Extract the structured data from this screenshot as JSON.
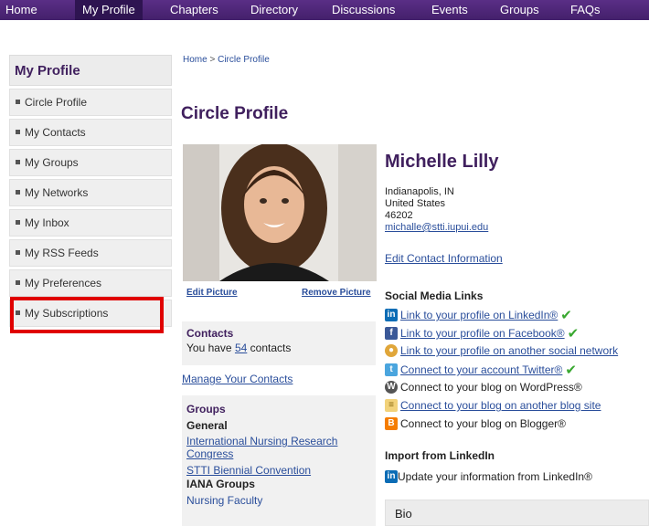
{
  "nav": {
    "items": [
      "Home",
      "My Profile",
      "Chapters",
      "Directory",
      "Discussions",
      "Events",
      "Groups",
      "FAQs"
    ],
    "active": "My Profile"
  },
  "sidebar": {
    "title": "My Profile",
    "items": [
      "Circle Profile",
      "My Contacts",
      "My Groups",
      "My Networks",
      "My Inbox",
      "My RSS Feeds",
      "My Preferences",
      "My Subscriptions"
    ],
    "highlighted": "My Subscriptions"
  },
  "breadcrumb": {
    "home": "Home",
    "sep": " > ",
    "current": "Circle Profile"
  },
  "page": {
    "title": "Circle Profile"
  },
  "photo": {
    "edit_label": "Edit Picture",
    "remove_label": "Remove Picture"
  },
  "profile": {
    "name": "Michelle Lilly",
    "city": "Indianapolis, IN",
    "country": "United States",
    "zip": "46202",
    "email": "michalle@stti.iupui.edu",
    "edit_contact": "Edit Contact Information"
  },
  "social": {
    "title": "Social Media Links",
    "links": [
      {
        "icon": "linkedin-icon",
        "label": "Link to your profile on LinkedIn®",
        "is_link": true,
        "connected": true
      },
      {
        "icon": "facebook-icon",
        "label": "Link to your profile on Facebook®",
        "is_link": true,
        "connected": true
      },
      {
        "icon": "social-network-icon",
        "label": "Link to your profile on another social network",
        "is_link": true,
        "connected": false
      },
      {
        "icon": "twitter-icon",
        "label": "Connect to your account Twitter®",
        "is_link": true,
        "connected": true
      },
      {
        "icon": "wordpress-icon",
        "label": "Connect to your blog on WordPress®",
        "is_link": false,
        "connected": false
      },
      {
        "icon": "blog-icon",
        "label": "Connect to your blog on another blog site",
        "is_link": true,
        "connected": false
      },
      {
        "icon": "blogger-icon",
        "label": "Connect to your blog on Blogger®",
        "is_link": false,
        "connected": false
      }
    ]
  },
  "import": {
    "title": "Import from LinkedIn",
    "label": "Update your information from LinkedIn®"
  },
  "bio": {
    "label": "Bio"
  },
  "contacts": {
    "title": "Contacts",
    "prefix": "You have ",
    "count": "54",
    "suffix": " contacts",
    "manage": "Manage Your Contacts"
  },
  "groups": {
    "title": "Groups",
    "general_label": "General",
    "general": [
      "International Nursing Research Congress",
      "STTI Biennial Convention"
    ],
    "iana_label": "IANA Groups",
    "iana": [
      "Nursing Faculty"
    ]
  },
  "colors": {
    "nav": "#4b2478",
    "accent": "#40205e",
    "link": "#2a4e9b",
    "highlight": "#e00000",
    "check": "#39a830"
  }
}
